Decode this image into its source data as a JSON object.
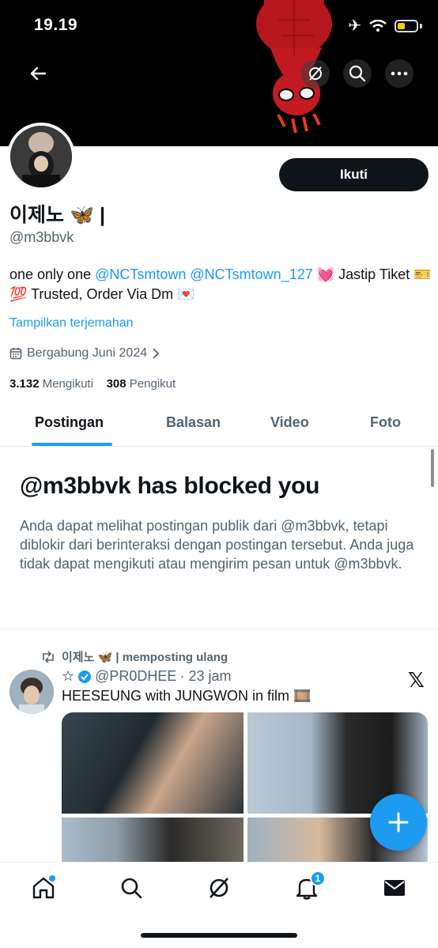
{
  "status_bar": {
    "time": "19.19"
  },
  "profile": {
    "name": "이제노 🦋 |",
    "handle": "@m3bbvk",
    "follow_label": "Ikuti",
    "bio_prefix": "one only one ",
    "bio_link1": "@NCTsmtown",
    "bio_space": " ",
    "bio_link2": "@NCTsmtown_127",
    "bio_suffix": " 💓 Jastip Tiket 🎫 💯 Trusted, Order Via Dm 💌",
    "translate": "Tampilkan terjemahan",
    "joined": "Bergabung Juni 2024",
    "following_count": "3.132",
    "following_label": "Mengikuti",
    "followers_count": "308",
    "followers_label": "Pengikut"
  },
  "tabs": [
    {
      "label": "Postingan",
      "active": true
    },
    {
      "label": "Balasan"
    },
    {
      "label": "Video"
    },
    {
      "label": "Foto"
    }
  ],
  "blocked": {
    "title": "@m3bbvk has blocked you",
    "text": "Anda dapat melihat postingan publik dari @m3bbvk, tetapi diblokir dari berinteraksi dengan postingan tersebut. Anda juga tidak dapat mengikuti atau mengirim pesan untuk @m3bbvk."
  },
  "post": {
    "repost_text": "이제노 🦋 | memposting ulang",
    "author_prefix": "☆",
    "author_handle": "@PR0DHEE",
    "time": "· 23 jam",
    "text": "HEESEUNG with JUNGWON in film 🎞️"
  },
  "nav": {
    "notifications_badge": "1"
  },
  "colors": {
    "accent": "#1d9bf0",
    "text": "#0f1419",
    "muted": "#536471"
  }
}
